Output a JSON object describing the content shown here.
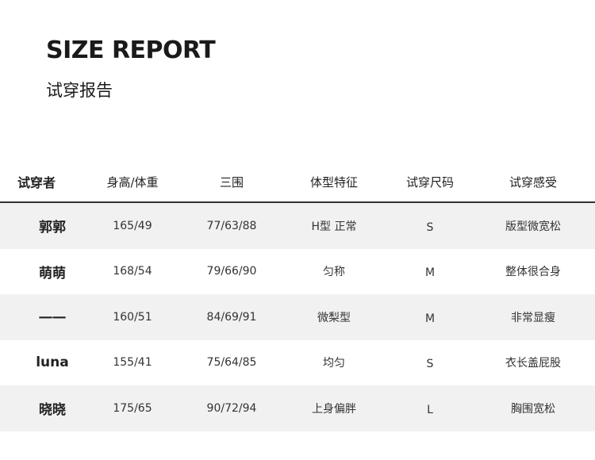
{
  "header": {
    "title": "SIZE REPORT",
    "subtitle": "试穿报告"
  },
  "table": {
    "columns": [
      "试穿者",
      "身高/体重",
      "三围",
      "体型特征",
      "试穿尺码",
      "试穿感受"
    ],
    "rows": [
      [
        "郭郭",
        "165/49",
        "77/63/88",
        "H型 正常",
        "S",
        "版型微宽松"
      ],
      [
        "萌萌",
        "168/54",
        "79/66/90",
        "匀称",
        "M",
        "整体很合身"
      ],
      [
        "一一",
        "160/51",
        "84/69/91",
        "微梨型",
        "M",
        "非常显瘦"
      ],
      [
        "luna",
        "155/41",
        "75/64/85",
        "均匀",
        "S",
        "衣长盖屁股"
      ],
      [
        "晓晓",
        "175/65",
        "90/72/94",
        "上身偏胖",
        "L",
        "胸围宽松"
      ]
    ]
  }
}
